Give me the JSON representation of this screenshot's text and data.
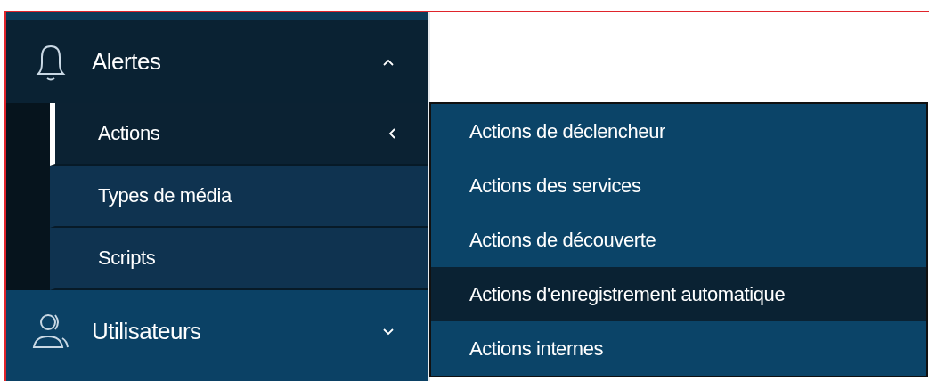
{
  "sidebar": {
    "items": [
      {
        "label": "Alertes",
        "expanded": true,
        "children": [
          {
            "label": "Actions",
            "selected": true,
            "has_submenu": true
          },
          {
            "label": "Types de média",
            "selected": false,
            "has_submenu": false
          },
          {
            "label": "Scripts",
            "selected": false,
            "has_submenu": false
          }
        ]
      },
      {
        "label": "Utilisateurs",
        "expanded": false
      }
    ]
  },
  "flyout": {
    "items": [
      {
        "label": "Actions de déclencheur",
        "selected": false
      },
      {
        "label": "Actions des services",
        "selected": false
      },
      {
        "label": "Actions de découverte",
        "selected": false
      },
      {
        "label": "Actions d'enregistrement automatique",
        "selected": true
      },
      {
        "label": "Actions internes",
        "selected": false
      }
    ]
  }
}
